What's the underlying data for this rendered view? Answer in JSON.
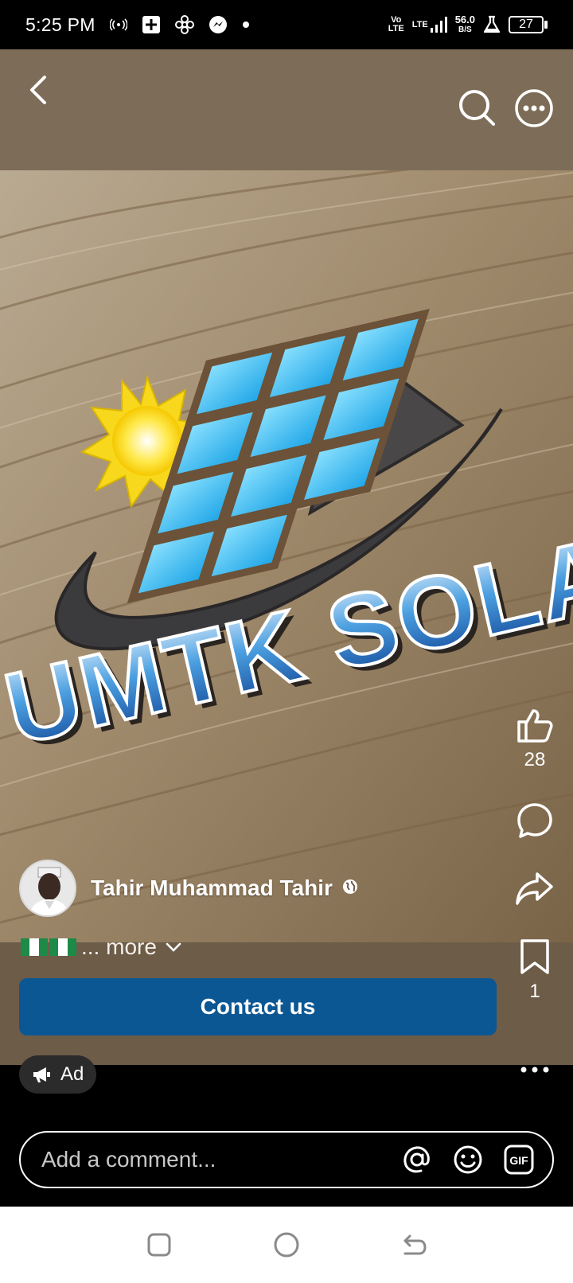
{
  "status_bar": {
    "time": "5:25 PM",
    "volte_top": "Vo",
    "volte_bottom": "LTE",
    "network": "LTE",
    "speed_value": "56.0",
    "speed_unit": "B/S",
    "battery": "27"
  },
  "post": {
    "image_text": "UMTK SOLAR",
    "author_name": "Tahir Muhammad Tahir",
    "caption_more": "... more",
    "cta_label": "Contact us",
    "ad_label": "Ad"
  },
  "actions": {
    "like_count": "28",
    "save_count": "1"
  },
  "comment": {
    "placeholder": "Add a comment..."
  },
  "colors": {
    "cta": "#0b5794",
    "media_bg": "#7e6e58",
    "flag_green": "#1d8a47"
  }
}
